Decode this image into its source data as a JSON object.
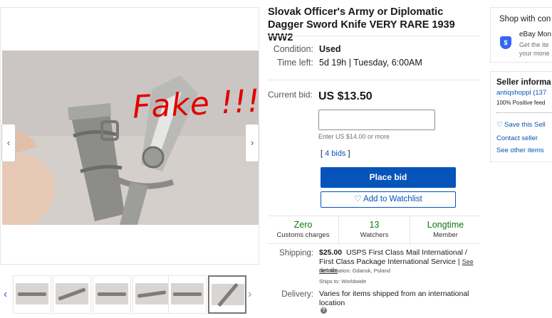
{
  "listing": {
    "title": "Slovak Officer's Army or Diplomatic Dagger Sword Knife VERY RARE 1939 WW2",
    "condition_label": "Condition:",
    "condition_value": "Used",
    "time_left_label": "Time left:",
    "time_left_value": "5d 19h  | Tuesday, 6:00AM",
    "current_bid_label": "Current bid:",
    "current_bid_value": "US $13.50",
    "bid_input_value": "",
    "bid_hint": "Enter US $14.00 or more",
    "bids_prefix": "[ ",
    "bids_link": "4 bids",
    "bids_suffix": " ]",
    "place_bid_label": "Place bid",
    "watchlist_label": "♡ Add to Watchlist"
  },
  "image": {
    "overlay_text": "Fake !!!",
    "thumbnail_count": 6,
    "active_thumbnail": 6
  },
  "stats": [
    {
      "value": "Zero",
      "label": "Customs charges"
    },
    {
      "value": "13",
      "label": "Watchers"
    },
    {
      "value": "Longtime",
      "label": "Member"
    }
  ],
  "shipping": {
    "label": "Shipping:",
    "price": "$25.00",
    "service": "USPS First Class Mail International / First Class Package International Service |",
    "see_details": "See details",
    "location": "Item location:  Gdansk, Poland",
    "ships_to": "Ships to:  Worldwide"
  },
  "delivery": {
    "label": "Delivery:",
    "value": "Varies for items shipped from an international location"
  },
  "sidebar": {
    "shop_title": "Shop with con",
    "money_title": "eBay Mon",
    "money_desc_1": "Get the ite",
    "money_desc_2": "your mone",
    "seller_title": "Seller informa",
    "seller_name": "antiqshoppl (137",
    "seller_feedback": "100% Positive feed",
    "save_seller": "♡  Save this Sell",
    "contact_seller": "Contact seller",
    "other_items": "See other items"
  },
  "colors": {
    "primary_blue": "#0654ba",
    "stat_green": "#0e7b0e",
    "fake_red": "#e20000"
  }
}
